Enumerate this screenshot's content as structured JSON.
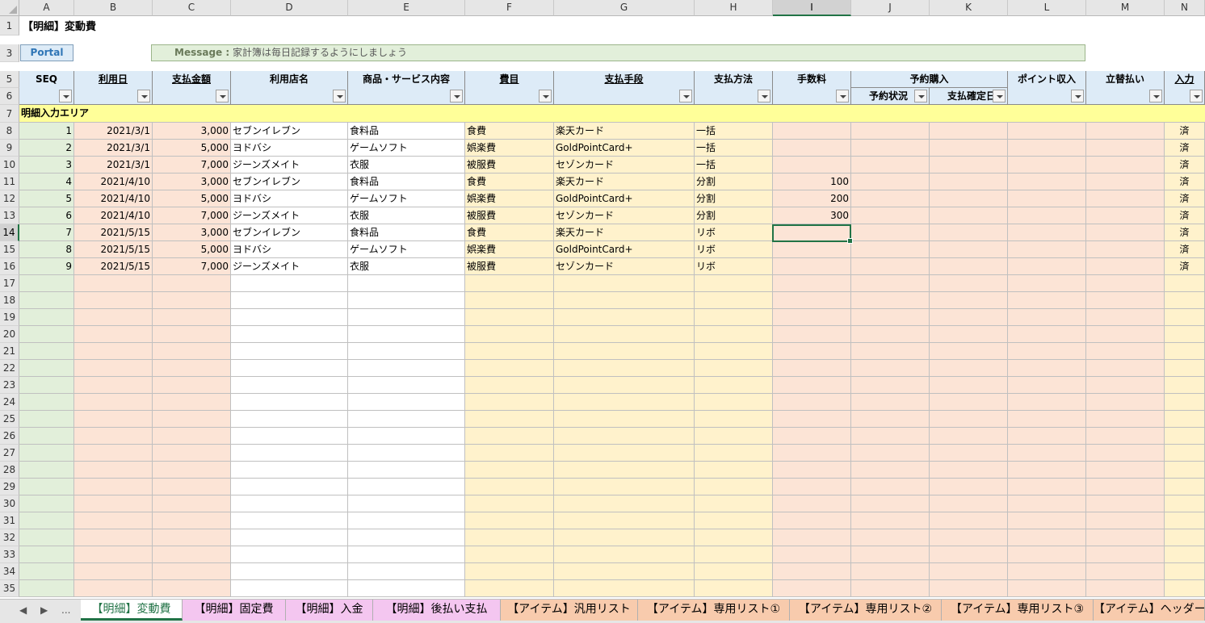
{
  "sheet_title": "【明細】変動費",
  "portal_label": "Portal",
  "message_label": "Message :",
  "message_text": "家計簿は毎日記録するようにしましょう",
  "area_label": "明細入力エリア",
  "columns": [
    "A",
    "B",
    "C",
    "D",
    "E",
    "F",
    "G",
    "H",
    "I",
    "J",
    "K",
    "L",
    "M",
    "N"
  ],
  "selected_column": "I",
  "selected_row": 14,
  "headers": {
    "seq": "SEQ",
    "date": "利用日",
    "amount": "支払金額",
    "store": "利用店名",
    "item": "商品・サービス内容",
    "category": "費目",
    "method": "支払手段",
    "paytype": "支払方法",
    "fee": "手数料",
    "reserve": "予約購入",
    "reserve_status": "予約状況",
    "reserve_date": "支払確定日",
    "points": "ポイント収入",
    "advance": "立替払い",
    "input": "入力"
  },
  "rows": [
    {
      "seq": "1",
      "date": "2021/3/1",
      "amount": "3,000",
      "store": "セブンイレブン",
      "item": "食料品",
      "category": "食費",
      "method": "楽天カード",
      "paytype": "一括",
      "fee": "",
      "input": "済"
    },
    {
      "seq": "2",
      "date": "2021/3/1",
      "amount": "5,000",
      "store": "ヨドバシ",
      "item": "ゲームソフト",
      "category": "娯楽費",
      "method": "GoldPointCard+",
      "paytype": "一括",
      "fee": "",
      "input": "済"
    },
    {
      "seq": "3",
      "date": "2021/3/1",
      "amount": "7,000",
      "store": "ジーンズメイト",
      "item": "衣服",
      "category": "被服費",
      "method": "セゾンカード",
      "paytype": "一括",
      "fee": "",
      "input": "済"
    },
    {
      "seq": "4",
      "date": "2021/4/10",
      "amount": "3,000",
      "store": "セブンイレブン",
      "item": "食料品",
      "category": "食費",
      "method": "楽天カード",
      "paytype": "分割",
      "fee": "100",
      "input": "済"
    },
    {
      "seq": "5",
      "date": "2021/4/10",
      "amount": "5,000",
      "store": "ヨドバシ",
      "item": "ゲームソフト",
      "category": "娯楽費",
      "method": "GoldPointCard+",
      "paytype": "分割",
      "fee": "200",
      "input": "済"
    },
    {
      "seq": "6",
      "date": "2021/4/10",
      "amount": "7,000",
      "store": "ジーンズメイト",
      "item": "衣服",
      "category": "被服費",
      "method": "セゾンカード",
      "paytype": "分割",
      "fee": "300",
      "input": "済"
    },
    {
      "seq": "7",
      "date": "2021/5/15",
      "amount": "3,000",
      "store": "セブンイレブン",
      "item": "食料品",
      "category": "食費",
      "method": "楽天カード",
      "paytype": "リボ",
      "fee": "",
      "input": "済"
    },
    {
      "seq": "8",
      "date": "2021/5/15",
      "amount": "5,000",
      "store": "ヨドバシ",
      "item": "ゲームソフト",
      "category": "娯楽費",
      "method": "GoldPointCard+",
      "paytype": "リボ",
      "fee": "",
      "input": "済"
    },
    {
      "seq": "9",
      "date": "2021/5/15",
      "amount": "7,000",
      "store": "ジーンズメイト",
      "item": "衣服",
      "category": "被服費",
      "method": "セゾンカード",
      "paytype": "リボ",
      "fee": "",
      "input": "済"
    }
  ],
  "empty_row_numbers": [
    17,
    18,
    19,
    20,
    21,
    22,
    23,
    24,
    25,
    26,
    27,
    28,
    29,
    30,
    31,
    32,
    33,
    34,
    35
  ],
  "tabs": [
    {
      "label": "【明細】変動費",
      "active": true,
      "color": "#ffffff"
    },
    {
      "label": "【明細】固定費",
      "active": false,
      "color": "#f4c6f0"
    },
    {
      "label": "【明細】入金",
      "active": false,
      "color": "#f4c6f0"
    },
    {
      "label": "【明細】後払い支払",
      "active": false,
      "color": "#f4c6f0"
    },
    {
      "label": "【アイテム】汎用リスト",
      "active": false,
      "color": "#f8cbad"
    },
    {
      "label": "【アイテム】専用リスト①",
      "active": false,
      "color": "#f8cbad"
    },
    {
      "label": "【アイテム】専用リスト②",
      "active": false,
      "color": "#f8cbad"
    },
    {
      "label": "【アイテム】専用リスト③",
      "active": false,
      "color": "#f8cbad"
    },
    {
      "label": "【アイテム】ヘッダー",
      "active": false,
      "color": "#f8cbad"
    }
  ],
  "nav": {
    "prev": "◀",
    "next": "▶",
    "more": "..."
  },
  "colors": {
    "seq_fill": "#e2efda",
    "date_fill": "#fce4d6",
    "text_fill": "#ffffff",
    "cat_fill": "#fff2cc",
    "header_fill": "#ddebf7",
    "area_fill": "#ffff99",
    "select": "#217346"
  }
}
